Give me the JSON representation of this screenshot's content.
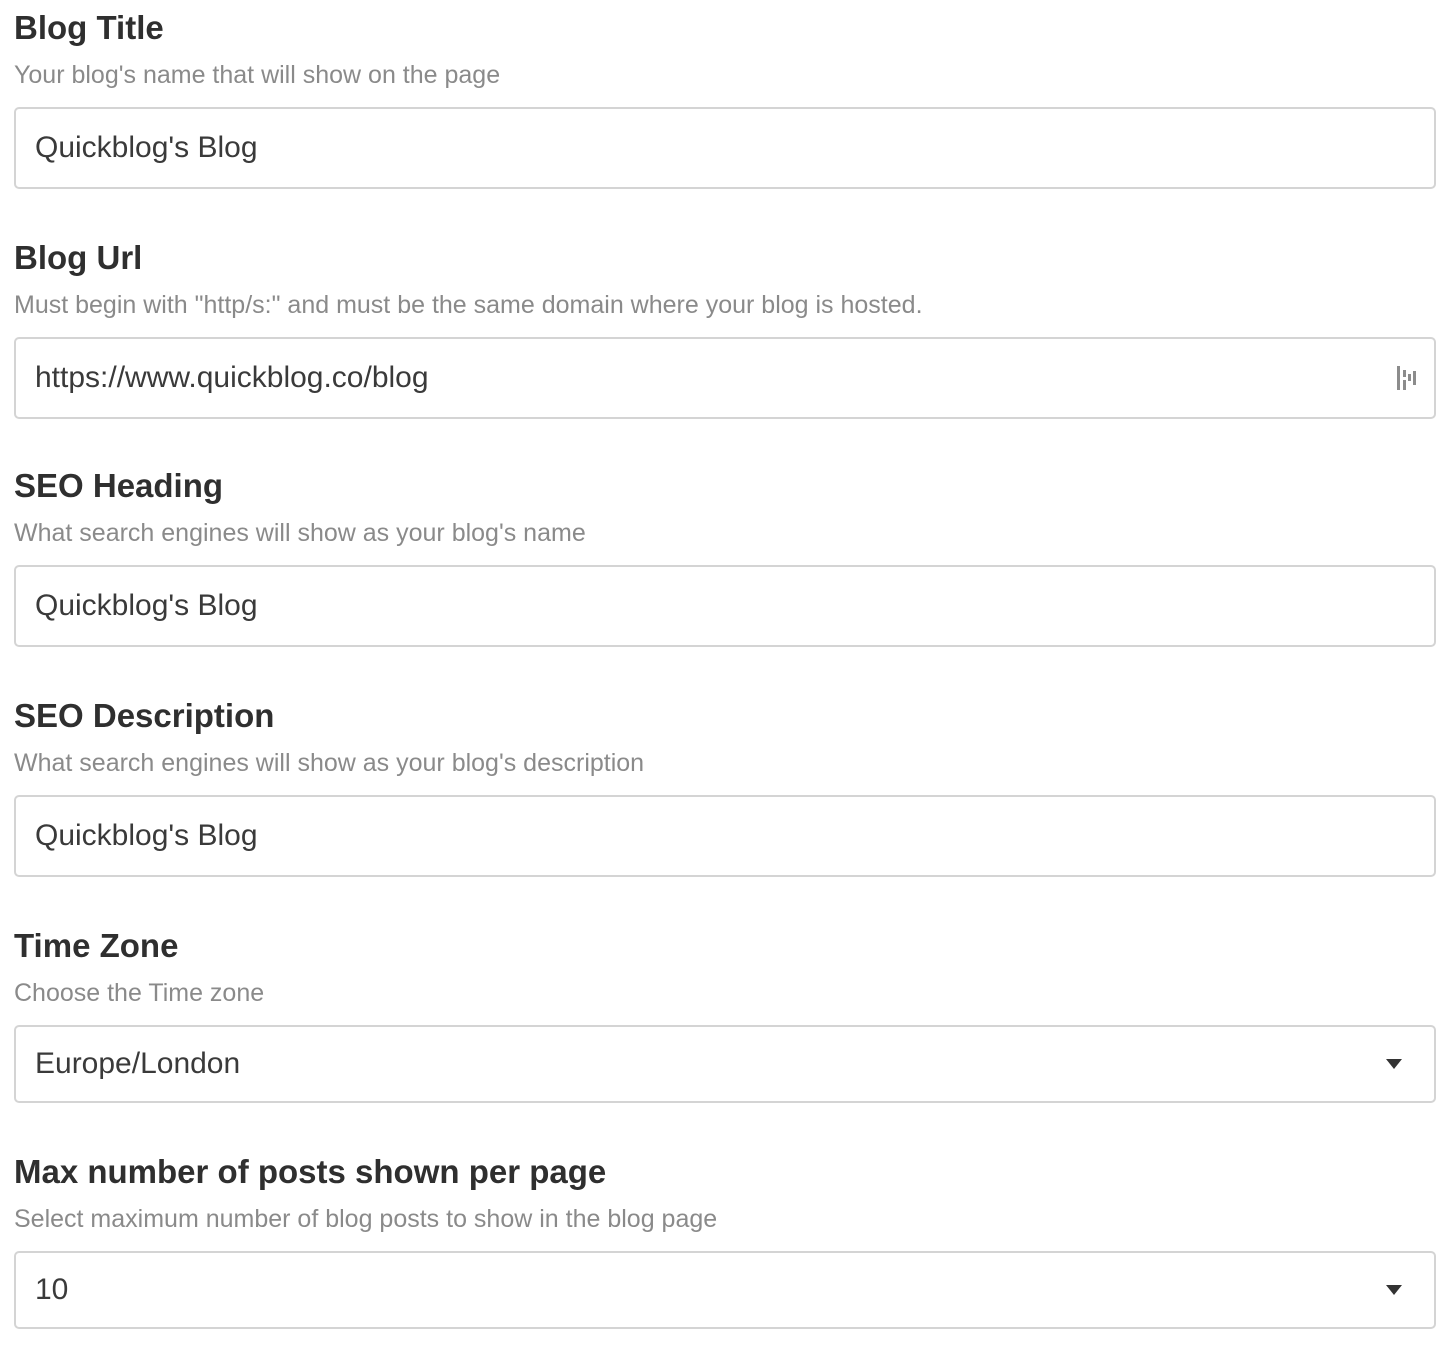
{
  "fields": {
    "blog_title": {
      "label": "Blog Title",
      "help": "Your blog's name that will show on the page",
      "value": "Quickblog's Blog"
    },
    "blog_url": {
      "label": "Blog Url",
      "help": "Must begin with \"http/s:\" and must be the same domain where your blog is hosted.",
      "value": "https://www.quickblog.co/blog",
      "trailing_icon": "password-manager-icon"
    },
    "seo_heading": {
      "label": "SEO Heading",
      "help": "What search engines will show as your blog's name",
      "value": "Quickblog's Blog"
    },
    "seo_description": {
      "label": "SEO Description",
      "help": "What search engines will show as your blog's description",
      "value": "Quickblog's Blog"
    },
    "time_zone": {
      "label": "Time Zone",
      "help": "Choose the Time zone",
      "selected": "Europe/London",
      "icon": "chevron-down-icon"
    },
    "max_posts": {
      "label": "Max number of posts shown per page",
      "help": "Select maximum number of blog posts to show in the blog page",
      "selected": "10",
      "icon": "chevron-down-icon"
    }
  }
}
